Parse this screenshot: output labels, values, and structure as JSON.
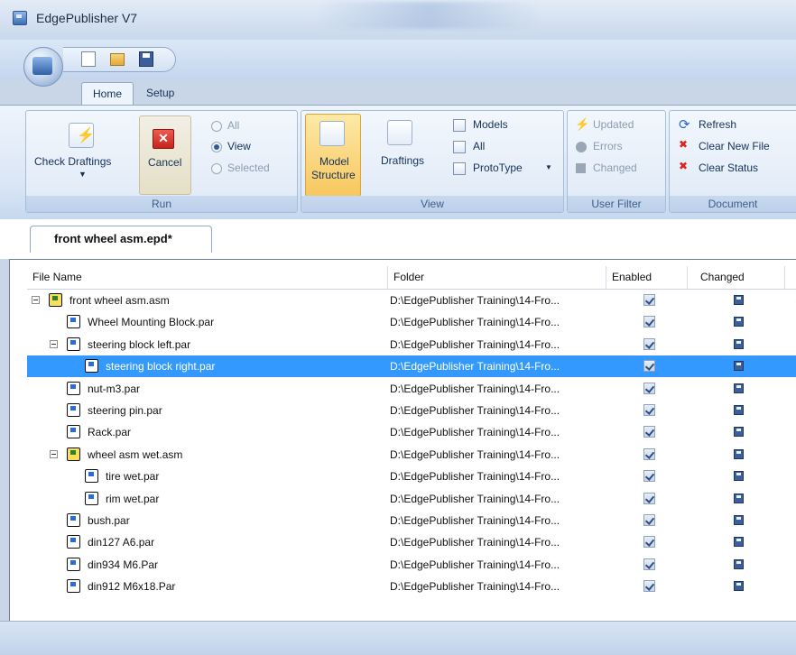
{
  "window": {
    "title": "EdgePublisher V7"
  },
  "tabs": {
    "home": "Home",
    "setup": "Setup"
  },
  "ribbon": {
    "run": {
      "label": "Run",
      "check_draftings": "Check Draftings",
      "cancel": "Cancel",
      "options": [
        {
          "label": "All",
          "selected": false
        },
        {
          "label": "View",
          "selected": true
        },
        {
          "label": "Selected",
          "selected": false
        }
      ]
    },
    "view": {
      "label": "View",
      "model_structure_line1": "Model",
      "model_structure_line2": "Structure",
      "draftings": "Draftings",
      "models": "Models",
      "all": "All",
      "prototype": "ProtoType"
    },
    "user_filter": {
      "label": "User Filter",
      "updated": "Updated",
      "errors": "Errors",
      "changed": "Changed"
    },
    "document": {
      "label": "Document",
      "refresh": "Refresh",
      "clear_new_files": "Clear New File",
      "clear_status": "Clear Status"
    }
  },
  "document_tab": "front wheel asm.epd*",
  "grid": {
    "columns": {
      "file_name": "File Name",
      "folder": "Folder",
      "enabled": "Enabled",
      "changed": "Changed"
    },
    "rows": [
      {
        "name": "front wheel asm.asm",
        "folder": "D:\\EdgePublisher Training\\14-Fro...",
        "type": "asm",
        "level": 0,
        "expander": true,
        "selected": false
      },
      {
        "name": "Wheel Mounting Block.par",
        "folder": "D:\\EdgePublisher Training\\14-Fro...",
        "type": "par",
        "level": 1,
        "expander": false,
        "selected": false
      },
      {
        "name": "steering block left.par",
        "folder": "D:\\EdgePublisher Training\\14-Fro...",
        "type": "par",
        "level": 1,
        "expander": true,
        "selected": false
      },
      {
        "name": "steering block right.par",
        "folder": "D:\\EdgePublisher Training\\14-Fro...",
        "type": "par",
        "level": 2,
        "expander": false,
        "selected": true
      },
      {
        "name": "nut-m3.par",
        "folder": "D:\\EdgePublisher Training\\14-Fro...",
        "type": "par",
        "level": 1,
        "expander": false,
        "selected": false
      },
      {
        "name": "steering pin.par",
        "folder": "D:\\EdgePublisher Training\\14-Fro...",
        "type": "par",
        "level": 1,
        "expander": false,
        "selected": false
      },
      {
        "name": "Rack.par",
        "folder": "D:\\EdgePublisher Training\\14-Fro...",
        "type": "par",
        "level": 1,
        "expander": false,
        "selected": false
      },
      {
        "name": "wheel asm wet.asm",
        "folder": "D:\\EdgePublisher Training\\14-Fro...",
        "type": "asm",
        "level": 1,
        "expander": true,
        "selected": false
      },
      {
        "name": "tire wet.par",
        "folder": "D:\\EdgePublisher Training\\14-Fro...",
        "type": "par",
        "level": 2,
        "expander": false,
        "selected": false
      },
      {
        "name": "rim wet.par",
        "folder": "D:\\EdgePublisher Training\\14-Fro...",
        "type": "par",
        "level": 2,
        "expander": false,
        "selected": false
      },
      {
        "name": "bush.par",
        "folder": "D:\\EdgePublisher Training\\14-Fro...",
        "type": "par",
        "level": 1,
        "expander": false,
        "selected": false
      },
      {
        "name": "din127 A6.par",
        "folder": "D:\\EdgePublisher Training\\14-Fro...",
        "type": "par",
        "level": 1,
        "expander": false,
        "selected": false
      },
      {
        "name": "din934 M6.Par",
        "folder": "D:\\EdgePublisher Training\\14-Fro...",
        "type": "par",
        "level": 1,
        "expander": false,
        "selected": false
      },
      {
        "name": "din912 M6x18.Par",
        "folder": "D:\\EdgePublisher Training\\14-Fro...",
        "type": "par",
        "level": 1,
        "expander": false,
        "selected": false
      }
    ]
  }
}
